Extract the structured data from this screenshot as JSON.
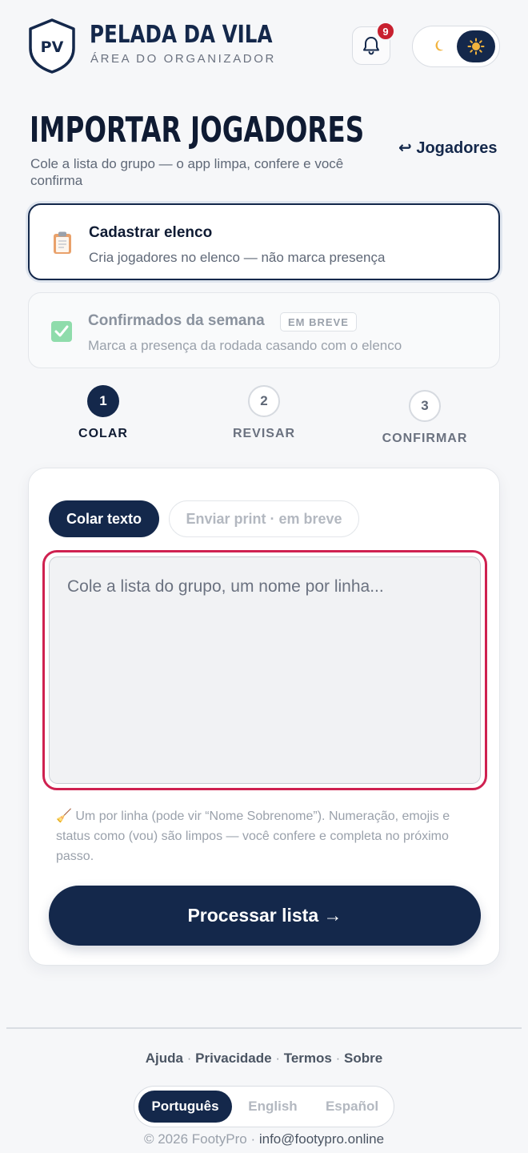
{
  "header": {
    "logo_initials": "PV",
    "brand_title": "PELADA DA VILA",
    "brand_subtitle": "ÁREA DO ORGANIZADOR",
    "notification_count": "9",
    "theme_moon": "🌙",
    "theme_sun": "☀"
  },
  "page": {
    "title": "IMPORTAR JOGADORES",
    "description": "Cole a lista do grupo — o app limpa, confere e você confirma",
    "back_link": "↩ Jogadores"
  },
  "modes": [
    {
      "title": "Cadastrar elenco",
      "description": "Cria jogadores no elenco — não marca presença",
      "icon": "clipboard-icon",
      "selected": true
    },
    {
      "title": "Confirmados da semana",
      "badge": "EM BREVE",
      "description": "Marca a presença da rodada casando com o elenco",
      "icon": "checkbox-icon",
      "selected": false
    }
  ],
  "stepper": [
    {
      "number": "1",
      "label": "COLAR",
      "active": true
    },
    {
      "number": "2",
      "label": "REVISAR",
      "active": false
    },
    {
      "number": "3",
      "label": "CONFIRMAR",
      "active": false
    }
  ],
  "input_tabs": {
    "paste": "Colar texto",
    "print": "Enviar print · em breve"
  },
  "list_input": {
    "value": "",
    "placeholder": "Cole a lista do grupo, um nome por linha..."
  },
  "hint": {
    "icon": "🧹",
    "text": "Um por linha (pode vir “Nome Sobrenome”). Numeração, emojis e status como (vou) são limpos — você confere e completa no próximo passo."
  },
  "process_button": "Processar lista →",
  "footer": {
    "links": [
      "Ajuda",
      "Privacidade",
      "Termos",
      "Sobre"
    ],
    "separator": "·",
    "languages": [
      "Português",
      "English",
      "Español"
    ],
    "selected_language": "Português",
    "copyright": "© 2026 FootyPro ·",
    "email": "info@footypro.online"
  },
  "colors": {
    "navy": "#14284b",
    "accent_red": "#cf2150",
    "badge_red": "#c8202f",
    "background": "#f6f7f9"
  }
}
